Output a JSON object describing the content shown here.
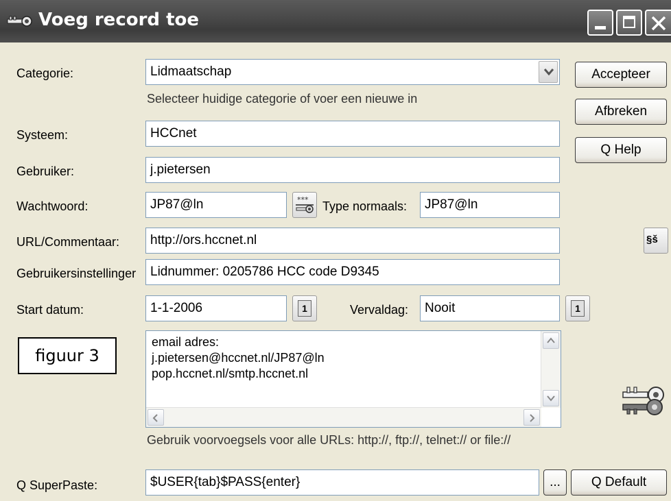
{
  "window": {
    "title": "Voeg record toe",
    "minimize_icon": "minimize-icon",
    "maximize_icon": "maximize-icon",
    "close_icon": "close-icon"
  },
  "labels": {
    "categorie": "Categorie:",
    "systeem": "Systeem:",
    "gebruiker": "Gebruiker:",
    "wachtwoord": "Wachtwoord:",
    "type_normaals": "Type normaals:",
    "url": "URL/Commentaar:",
    "gebruikersinstellingen": "Gebruikersinstellinger",
    "start_datum": "Start datum:",
    "vervaldag": "Vervaldag:",
    "q_superpaste": "Q SuperPaste:"
  },
  "fields": {
    "categorie": "Lidmaatschap",
    "systeem": "HCCnet",
    "gebruiker": "j.pietersen",
    "wachtwoord": "JP87@ln",
    "type_normaals": "JP87@ln",
    "url": "http://ors.hccnet.nl",
    "gebruikersinstellingen": "Lidnummer: 0205786   HCC code D9345",
    "start_datum": "1-1-2006",
    "vervaldag": "Nooit",
    "q_superpaste": "$USER{tab}$PASS{enter}"
  },
  "notes": [
    "email adres:",
    "j.pietersen@hccnet.nl/JP87@ln",
    "pop.hccnet.nl/smtp.hccnet.nl"
  ],
  "hints": {
    "categorie": "Selecteer huidige categorie of voer een nieuwe in",
    "urls": "Gebruik voorvoegsels voor alle URLs: http://, ftp://, telnet:// or file://"
  },
  "buttons": {
    "accepteer": "Accepteer",
    "afbreken": "Afbreken",
    "q_help": "Q Help",
    "browse": "...",
    "q_default": "Q Default"
  },
  "icons": {
    "password_toggle": "password-mask-icon",
    "special_chars": "special-chars-icon",
    "calendar": "calendar-icon",
    "keys": "keys-icon"
  },
  "special_chars_glyph": "§ š",
  "calendar_glyph": "1",
  "overlay": {
    "figure_label": "figuur 3"
  }
}
